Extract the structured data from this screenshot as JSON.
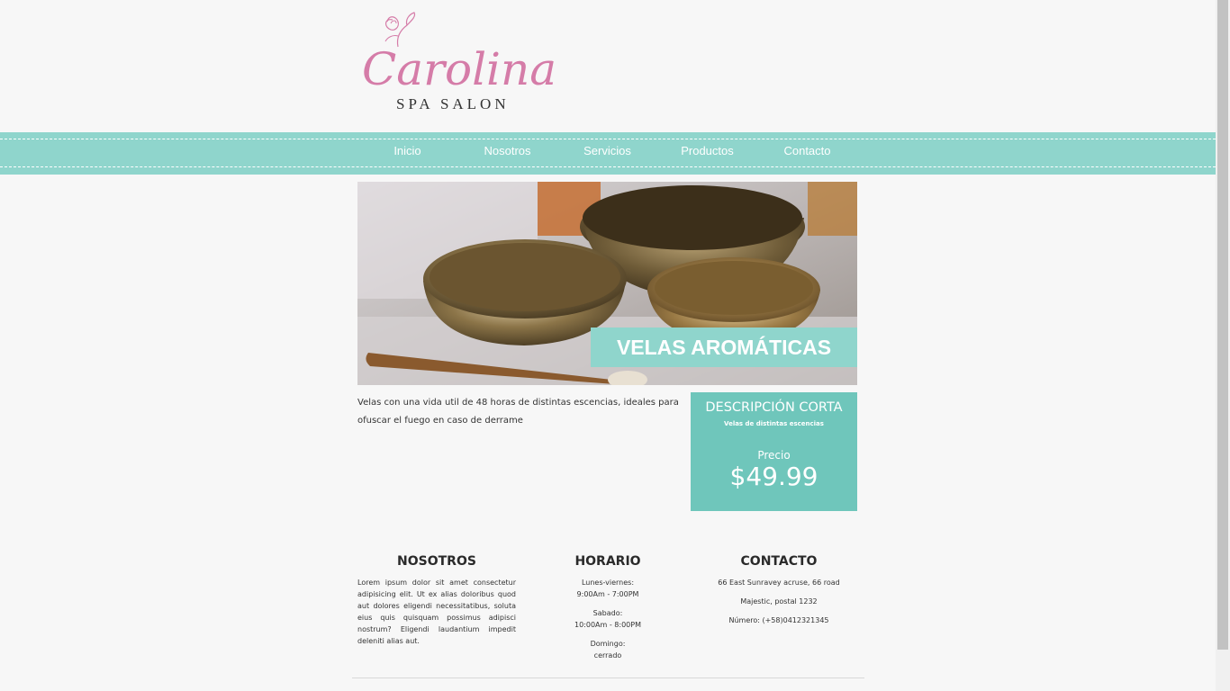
{
  "logo": {
    "name": "Carolina",
    "subtitle": "SPA SALON",
    "icon": "flower-icon"
  },
  "nav": {
    "items": [
      {
        "label": "Inicio"
      },
      {
        "label": "Nosotros"
      },
      {
        "label": "Servicios"
      },
      {
        "label": "Productos"
      },
      {
        "label": "Contacto"
      }
    ]
  },
  "product": {
    "title": "VELAS AROMÁTICAS",
    "description": "Velas con una vida util de 48 horas de distintas escencias, ideales para ofuscar el fuego en caso de derrame",
    "short_title": "DESCRIPCIÓN CORTA",
    "short_text": "Velas de distintas escencias",
    "price_label": "Precio",
    "price": "$49.99"
  },
  "footer": {
    "nosotros": {
      "title": "NOSOTROS",
      "text": "Lorem ipsum dolor sit amet consectetur adipisicing elit. Ut ex alias doloribus quod aut dolores eligendi necessitatibus, soluta eius quis quisquam possimus adipisci nostrum? Eligendi laudantium impedit deleniti alias aut."
    },
    "horario": {
      "title": "HORARIO",
      "blocks": [
        {
          "day": "Lunes-viernes:",
          "hours": "9:00Am - 7:00PM"
        },
        {
          "day": "Sabado:",
          "hours": "10:00Am - 8:00PM"
        },
        {
          "day": "Domingo:",
          "hours": "cerrado"
        }
      ]
    },
    "contacto": {
      "title": "CONTACTO",
      "lines": [
        "66 East Sunravey acruse, 66 road",
        "Majestic, postal 1232",
        "Número: (+58)0412321345"
      ]
    }
  },
  "colors": {
    "accent": "#8fd5cc",
    "price_box": "#6fc6bb",
    "logo_pink": "#d57ca8"
  }
}
